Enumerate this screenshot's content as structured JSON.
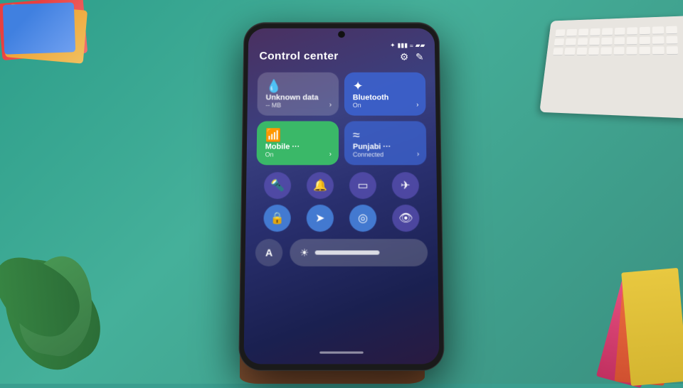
{
  "background": {
    "color": "#3a9e8f"
  },
  "phone": {
    "statusBar": {
      "icons": [
        "bluetooth",
        "signal",
        "wifi",
        "battery"
      ]
    },
    "controlCenter": {
      "title": "Control center",
      "headerIcons": [
        "settings",
        "edit"
      ],
      "tiles": [
        {
          "id": "data",
          "title": "Unknown data",
          "subtitle": "-- MB",
          "icon": "💧",
          "type": "data",
          "hasArrow": true
        },
        {
          "id": "bluetooth",
          "title": "Bluetooth",
          "subtitle": "On",
          "icon": "🔷",
          "type": "bluetooth",
          "hasArrow": true
        },
        {
          "id": "mobile",
          "title": "Mobile ···",
          "subtitle": "On",
          "icon": "📶",
          "type": "mobile",
          "hasArrow": true
        },
        {
          "id": "wifi",
          "title": "Punjabi ···",
          "subtitle": "Connected",
          "icon": "📡",
          "type": "wifi",
          "hasArrow": true
        }
      ],
      "iconRow1": [
        {
          "id": "flashlight",
          "icon": "🔦",
          "label": "flashlight"
        },
        {
          "id": "bell",
          "icon": "🔔",
          "label": "bell"
        },
        {
          "id": "screen-mirror",
          "icon": "⬛",
          "label": "screen-mirror"
        },
        {
          "id": "airplane",
          "icon": "✈️",
          "label": "airplane"
        }
      ],
      "iconRow2": [
        {
          "id": "lock",
          "icon": "🔒",
          "label": "lock"
        },
        {
          "id": "location",
          "icon": "➤",
          "label": "location"
        },
        {
          "id": "focus",
          "icon": "◎",
          "label": "focus"
        },
        {
          "id": "eye",
          "icon": "👁",
          "label": "eye"
        }
      ],
      "bottomControls": {
        "fontLabel": "A",
        "brightnessIcon": "☀",
        "brightnessPercent": 55
      }
    }
  }
}
